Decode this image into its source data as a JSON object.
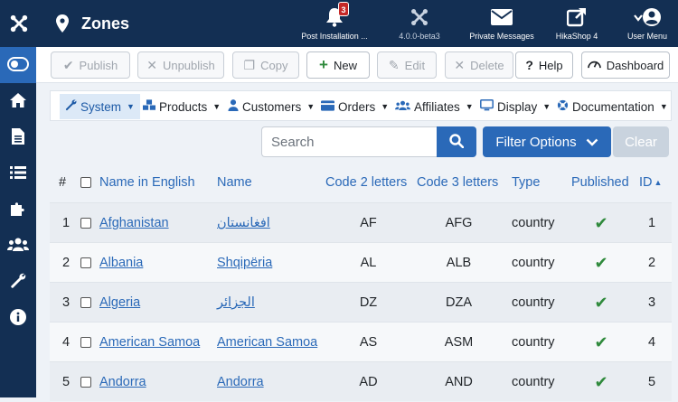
{
  "header": {
    "title": "Zones",
    "items": [
      {
        "label": "Post Installation ...",
        "badge": "3",
        "icon": "bell-icon"
      },
      {
        "label": "4.0.0-beta3",
        "icon": "joomla-icon"
      },
      {
        "label": "Private Messages",
        "icon": "envelope-icon"
      },
      {
        "label": "HikaShop 4",
        "icon": "external-link-icon"
      },
      {
        "label": "User Menu",
        "icon": "user-icon"
      }
    ]
  },
  "sidebar": {
    "items": [
      "toggle-icon",
      "home-icon",
      "file-icon",
      "list-icon",
      "puzzle-icon",
      "users-icon",
      "wrench-icon",
      "info-icon"
    ]
  },
  "toolbar": {
    "publish": "Publish",
    "unpublish": "Unpublish",
    "copy": "Copy",
    "new": "New",
    "edit": "Edit",
    "delete": "Delete",
    "help": "Help",
    "dashboard": "Dashboard"
  },
  "menu": {
    "items": [
      "System",
      "Products",
      "Customers",
      "Orders",
      "Affiliates",
      "Display",
      "Documentation"
    ]
  },
  "search": {
    "placeholder": "Search",
    "filter_label": "Filter Options",
    "clear_label": "Clear"
  },
  "table": {
    "headers": {
      "num": "#",
      "name_en": "Name in English",
      "name": "Name",
      "code2": "Code 2 letters",
      "code3": "Code 3 letters",
      "type": "Type",
      "published": "Published",
      "id": "ID"
    },
    "rows": [
      {
        "num": "1",
        "name_en": "Afghanistan",
        "name": "افغانستان",
        "code2": "AF",
        "code3": "AFG",
        "type": "country",
        "id": "1"
      },
      {
        "num": "2",
        "name_en": "Albania",
        "name": "Shqipëria",
        "code2": "AL",
        "code3": "ALB",
        "type": "country",
        "id": "2"
      },
      {
        "num": "3",
        "name_en": "Algeria",
        "name": "الجزائر",
        "code2": "DZ",
        "code3": "DZA",
        "type": "country",
        "id": "3"
      },
      {
        "num": "4",
        "name_en": "American Samoa",
        "name": "American Samoa",
        "code2": "AS",
        "code3": "ASM",
        "type": "country",
        "id": "4"
      },
      {
        "num": "5",
        "name_en": "Andorra",
        "name": "Andorra",
        "code2": "AD",
        "code3": "AND",
        "type": "country",
        "id": "5"
      }
    ]
  },
  "colors": {
    "header_bg": "#132f53",
    "accent": "#2a69b8",
    "published_check": "#2f8a3c"
  }
}
